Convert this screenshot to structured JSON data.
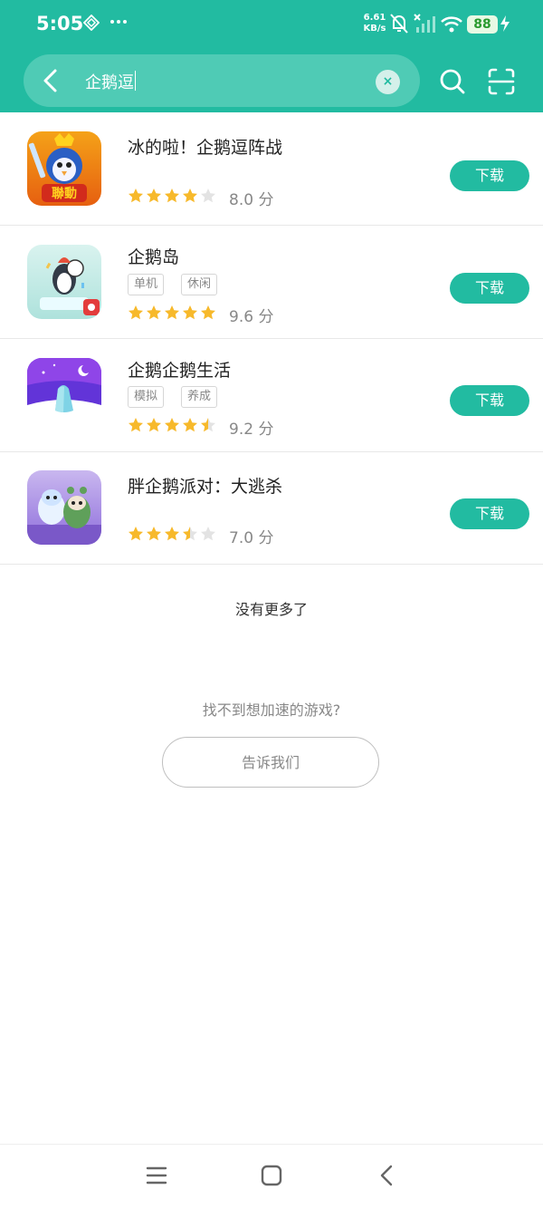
{
  "status_bar": {
    "time": "5:05",
    "network_speed_value": "6.61",
    "network_speed_unit": "KB/s",
    "battery": "88",
    "icons": [
      "diamond-icon",
      "more-dots-icon",
      "bell-muted-icon",
      "signal-icon",
      "wifi-icon",
      "battery-icon",
      "charging-icon"
    ]
  },
  "search": {
    "query": "企鹅逗",
    "clear_symbol": "×"
  },
  "apps": [
    {
      "title": "冰的啦！企鹅逗阵战",
      "tags": [],
      "rating": 4,
      "score": "8.0 分",
      "download_label": "下载"
    },
    {
      "title": "企鹅岛",
      "tags": [
        "单机",
        "休闲"
      ],
      "rating": 5,
      "score": "9.6 分",
      "download_label": "下载"
    },
    {
      "title": "企鹅企鹅生活",
      "tags": [
        "模拟",
        "养成"
      ],
      "rating": 4.5,
      "score": "9.2 分",
      "download_label": "下载"
    },
    {
      "title": "胖企鹅派对：大逃杀",
      "tags": [],
      "rating": 3.5,
      "score": "7.0 分",
      "download_label": "下载"
    }
  ],
  "app_icon_texts": {
    "first_badge": "聯動"
  },
  "footer": {
    "no_more": "没有更多了",
    "cant_find": "找不到想加速的游戏?",
    "tell_us": "告诉我们"
  },
  "colors": {
    "accent": "#22bba1",
    "star": "#f7b92b",
    "star_empty": "#e3e3e3"
  }
}
